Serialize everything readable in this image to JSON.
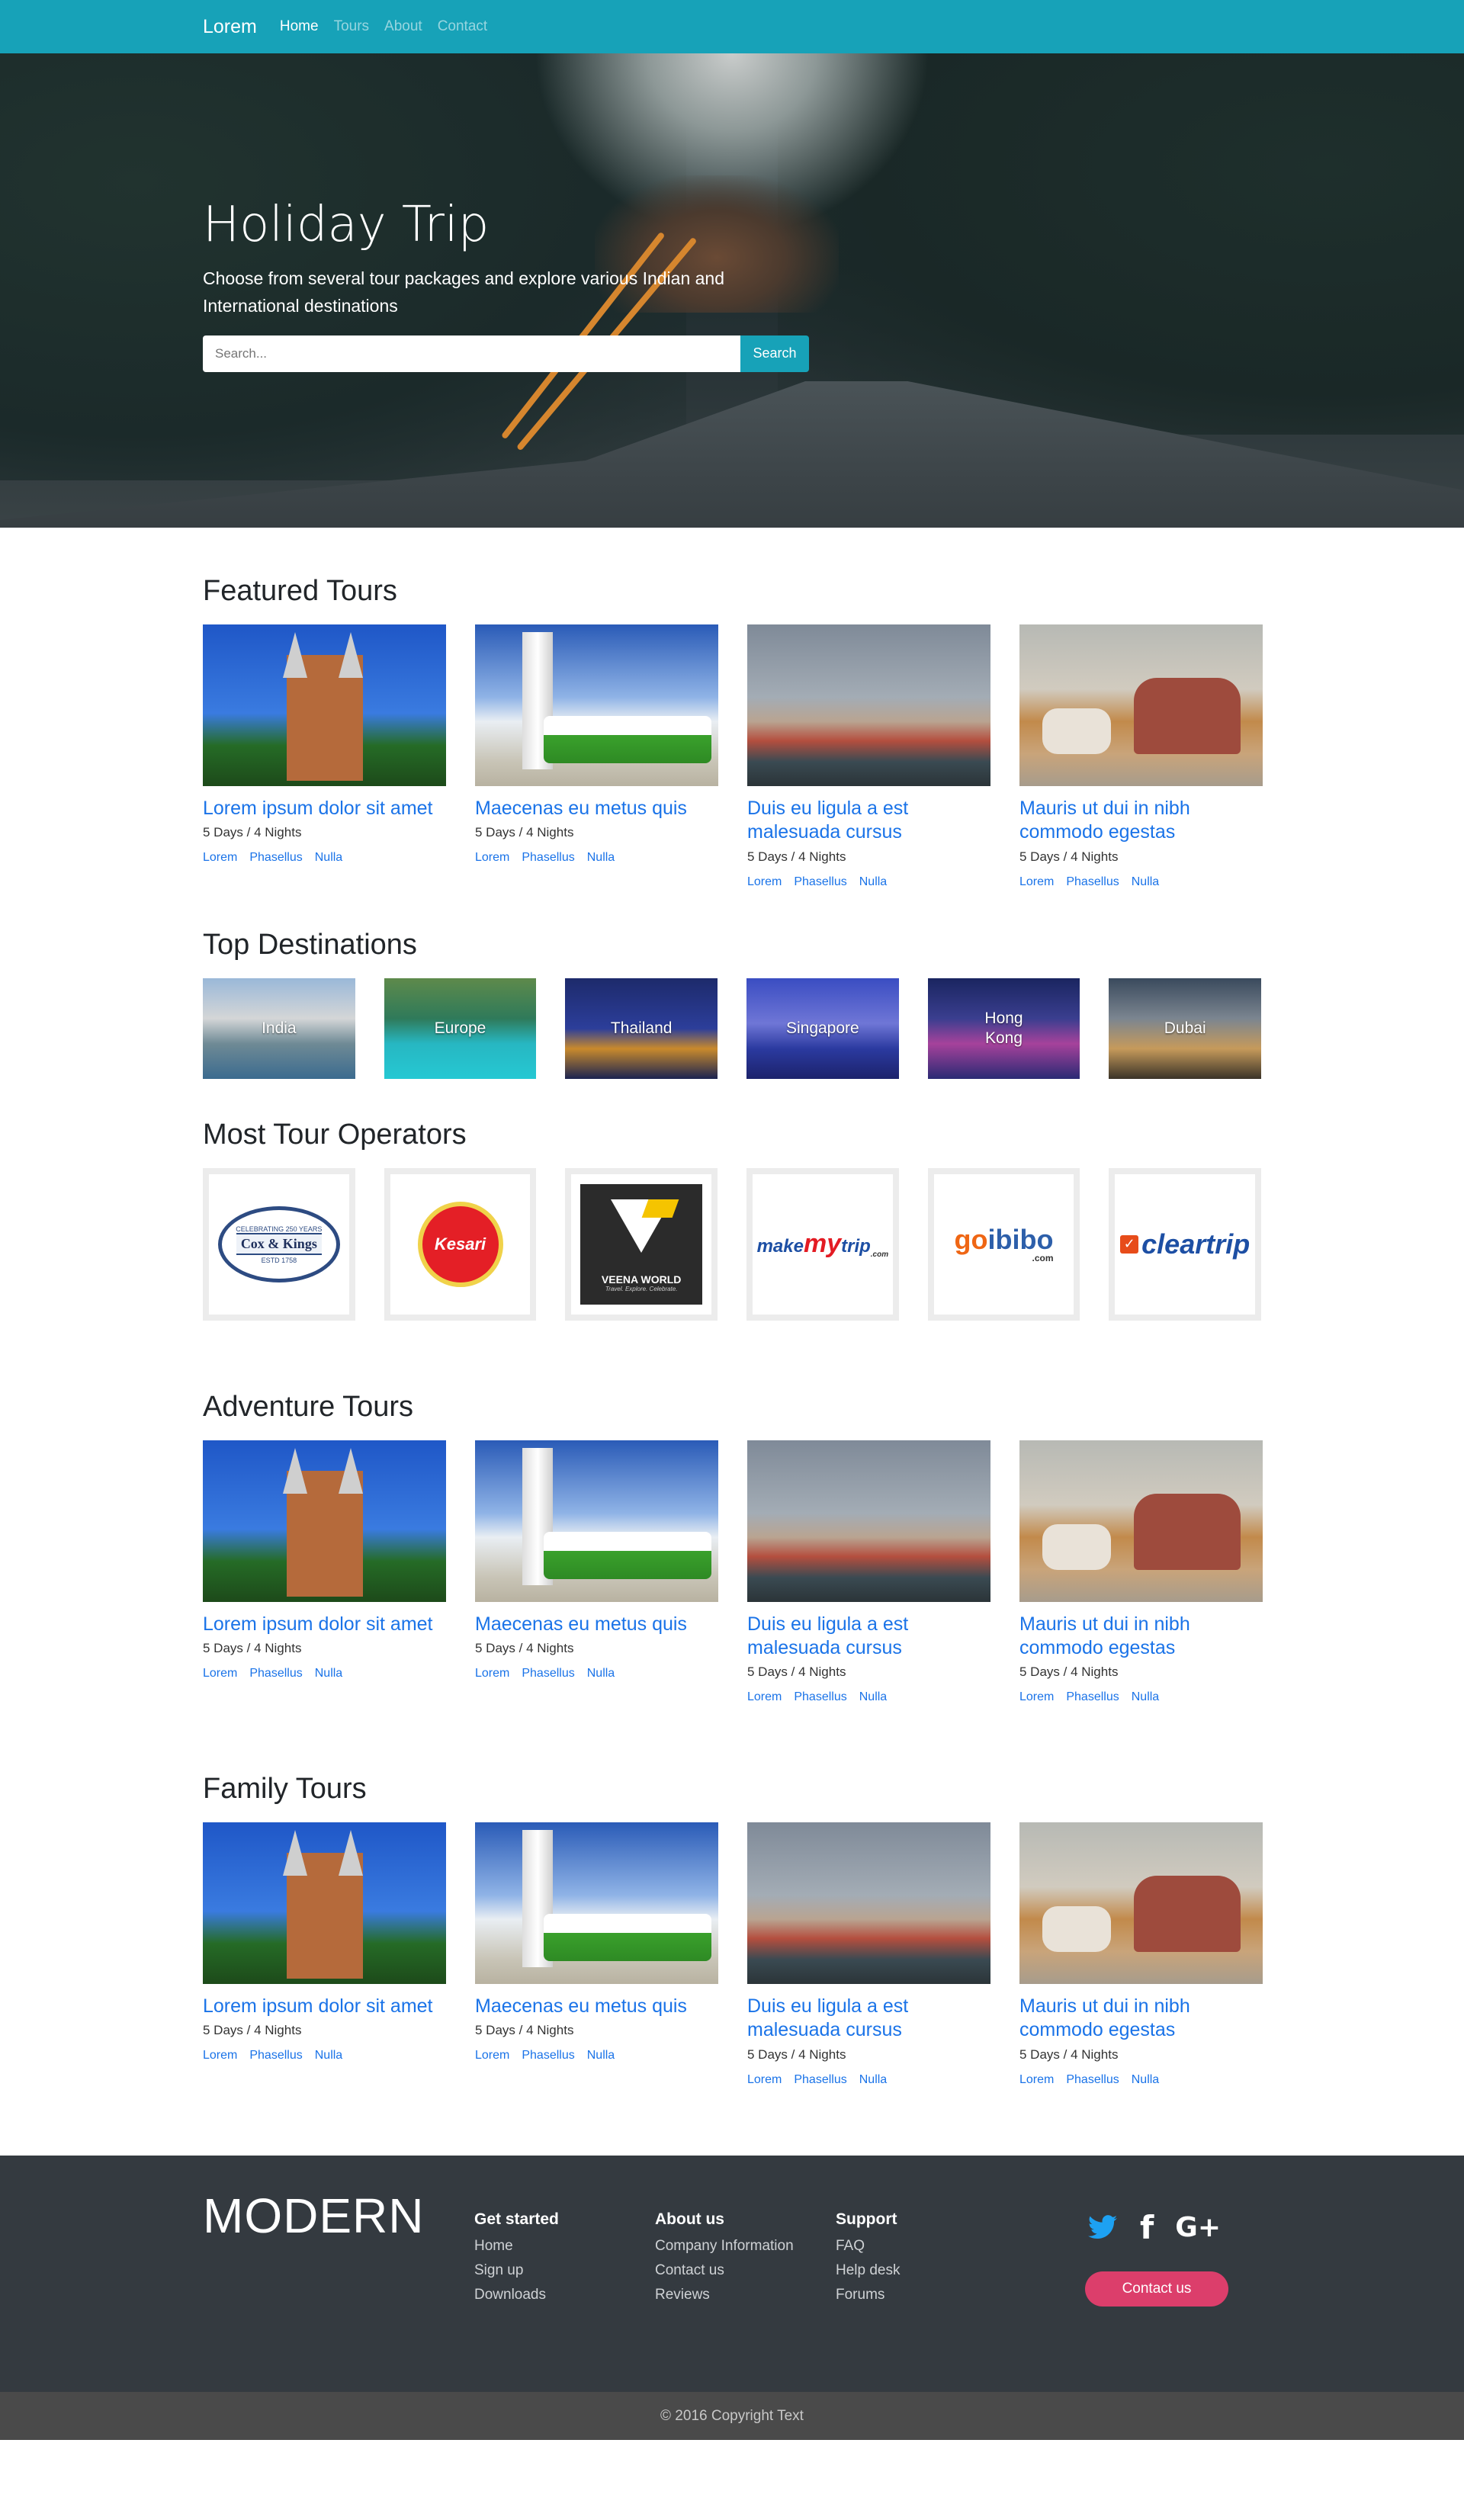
{
  "nav": {
    "brand": "Lorem",
    "links": [
      "Home",
      "Tours",
      "About",
      "Contact"
    ]
  },
  "hero": {
    "title": "Holiday Trip",
    "subtitle": "Choose from several tour packages and explore various Indian and International destinations",
    "search_placeholder": "Search...",
    "search_button": "Search"
  },
  "tour_cards": [
    {
      "title": "Lorem ipsum dolor sit amet",
      "duration": "5 Days / 4 Nights",
      "tags": [
        "Lorem",
        "Phasellus",
        "Nulla"
      ]
    },
    {
      "title": "Maecenas eu metus quis",
      "duration": "5 Days / 4 Nights",
      "tags": [
        "Lorem",
        "Phasellus",
        "Nulla"
      ]
    },
    {
      "title": "Duis eu ligula a est malesuada cursus",
      "duration": "5 Days / 4 Nights",
      "tags": [
        "Lorem",
        "Phasellus",
        "Nulla"
      ]
    },
    {
      "title": "Mauris ut dui in nibh commodo egestas",
      "duration": "5 Days / 4 Nights",
      "tags": [
        "Lorem",
        "Phasellus",
        "Nulla"
      ]
    }
  ],
  "sections": {
    "featured": "Featured Tours",
    "destinations": "Top Destinations",
    "operators": "Most Tour Operators",
    "adventure": "Adventure Tours",
    "family": "Family Tours"
  },
  "destinations": [
    "India",
    "Europe",
    "Thailand",
    "Singapore",
    "Hong Kong",
    "Dubai"
  ],
  "operators": {
    "cox_kings": {
      "name": "Cox & Kings",
      "top": "CELEBRATING 250 YEARS",
      "bottom": "ESTD 1758"
    },
    "kesari": "Kesari",
    "veena": {
      "name": "VEENA WORLD",
      "tagline": "Travel. Explore. Celebrate."
    },
    "mmt": {
      "pre": "make",
      "my": "my",
      "post": "trip",
      "dotcom": ".com"
    },
    "goibibo": {
      "goi": "go",
      "ibibo": "ibibo",
      "dotcom": ".com"
    },
    "cleartrip": "cleartrip"
  },
  "footer": {
    "brand": "MODERN",
    "cols": [
      {
        "heading": "Get started",
        "links": [
          "Home",
          "Sign up",
          "Downloads"
        ]
      },
      {
        "heading": "About us",
        "links": [
          "Company Information",
          "Contact us",
          "Reviews"
        ]
      },
      {
        "heading": "Support",
        "links": [
          "FAQ",
          "Help desk",
          "Forums"
        ]
      }
    ],
    "contact_button": "Contact us",
    "copyright": "© 2016 Copyright Text"
  },
  "colors": {
    "navbar": "#17a2b8",
    "link": "#1a73e8",
    "footer": "#343a40",
    "cta": "#dc3e6b"
  }
}
